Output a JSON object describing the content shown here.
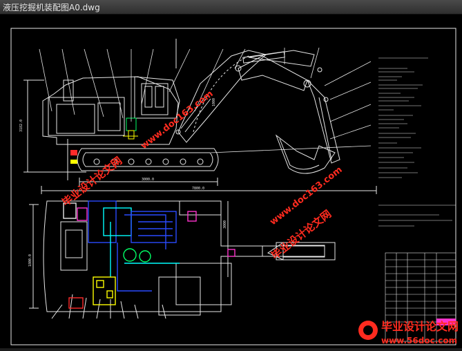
{
  "window": {
    "title": "液压挖掘机装配图A0.dwg"
  },
  "drawing": {
    "dimensions": {
      "total_length": "7800.0",
      "track_length": "3000.0",
      "height": "3182.0",
      "plan_width": "1800.0",
      "upper_label_a": "1000",
      "upper_label_b": "3000"
    }
  },
  "watermarks": {
    "site_text": "www.doc163.com",
    "cn_text": "毕业设计论文网"
  },
  "footer": {
    "cn": "毕业设计论文网",
    "url": "www.56doc.com"
  },
  "colors": {
    "background": "#000000",
    "drawing_white": "#e8e8e8",
    "cyan": "#00ffff",
    "blue": "#2a4bff",
    "yellow": "#ffff00",
    "green": "#00ff66",
    "red": "#ff2a2a",
    "magenta": "#ff33cc",
    "watermark_red": "#ff2b1f"
  }
}
